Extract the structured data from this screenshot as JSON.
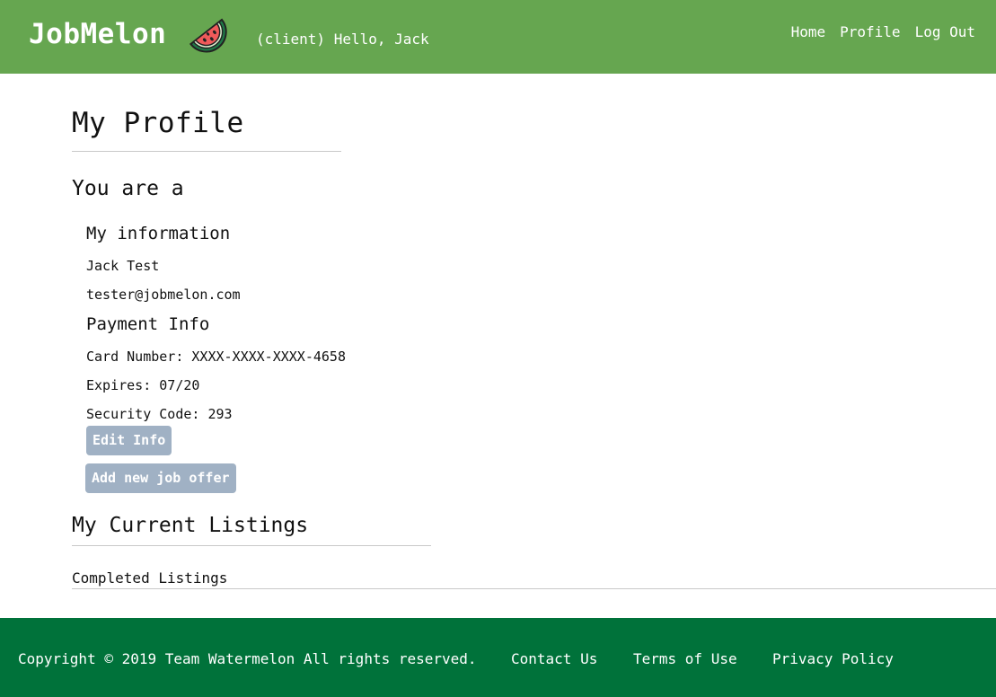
{
  "header": {
    "brand": "JobMelon",
    "logo_icon": "watermelon-icon",
    "greeting": "(client) Hello, Jack",
    "nav": [
      "Home",
      "Profile",
      "Log Out"
    ]
  },
  "profile": {
    "title": "My Profile",
    "role_line": "You are a",
    "info_heading": "My information",
    "name": "Jack Test",
    "email": "tester@jobmelon.com",
    "payment_heading": "Payment Info",
    "card_number": "Card Number: XXXX-XXXX-XXXX-4658",
    "expires": "Expires: 07/20",
    "security_code": "Security Code: 293",
    "edit_button": "Edit Info",
    "add_offer_button": "Add new job offer"
  },
  "listings": {
    "current_title": "My Current Listings",
    "completed_title": "Completed Listings"
  },
  "footer": {
    "copyright": "Copyright © 2019 Team Watermelon All rights reserved.",
    "links": [
      "Contact Us",
      "Terms of Use",
      "Privacy Policy"
    ]
  },
  "colors": {
    "header_bg": "#66a650",
    "footer_bg": "#00723a",
    "button_bg": "#a0b1c4"
  }
}
